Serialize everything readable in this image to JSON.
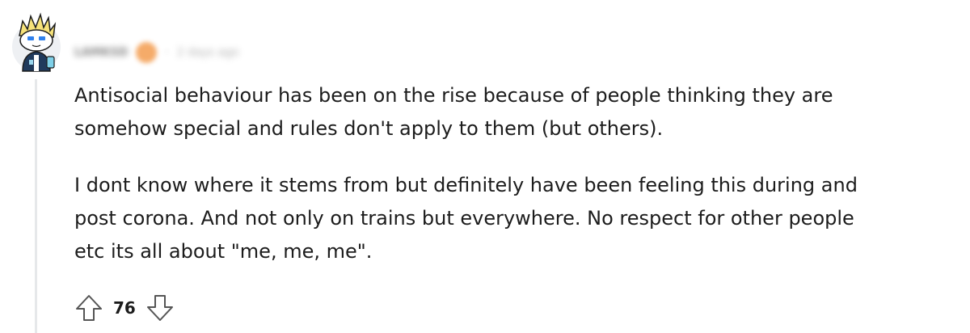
{
  "comment": {
    "author": "LAMKSD",
    "separator": "·",
    "timestamp": "2 days ago",
    "paragraphs": [
      "Antisocial behaviour has been on the rise because of people thinking they are\nsomehow special and rules don't apply to them (but others).",
      "I dont know where it stems from but definitely have been feeling this during and\npost corona. And not only on trains but everywhere. No respect for other people\netc its all about \"me, me, me\"."
    ],
    "score": "76",
    "avatar_icon": "snoo-avatar-icon",
    "upvote_icon": "arrow-up-icon",
    "downvote_icon": "arrow-down-icon"
  }
}
